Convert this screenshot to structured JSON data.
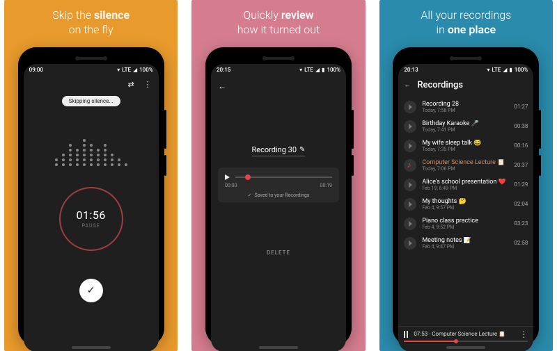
{
  "panels": [
    {
      "caption_line1": "Skip the",
      "caption_bold1": "silence",
      "caption_line2": "on the fly"
    },
    {
      "caption_line1": "Quickly",
      "caption_bold1": "review",
      "caption_line2": "how it turned out"
    },
    {
      "caption_line1": "All your recordings",
      "caption_line2": "in",
      "caption_bold2": "one place"
    }
  ],
  "status": {
    "time1": "09:00",
    "time2": "20:15",
    "time3": "20:13",
    "network": "LTE",
    "battery": "100%"
  },
  "recorder": {
    "chip": "Skipping silence...",
    "timer": "01:56",
    "timer_sub": "PAUSE"
  },
  "review": {
    "title": "Recording 30",
    "time_start": "00:00",
    "time_end": "00:19",
    "saved_text": "Saved to your Recordings",
    "delete_label": "DELETE"
  },
  "list": {
    "title": "Recordings",
    "items": [
      {
        "name": "Recording 28",
        "sub": "Today, 7:58 PM",
        "dur": "01:27",
        "accent": false,
        "emoji": ""
      },
      {
        "name": "Birthday Karaoke",
        "sub": "Today, 7:41 PM",
        "dur": "00:38",
        "accent": false,
        "emoji": "🎤"
      },
      {
        "name": "My wife sleep talk",
        "sub": "Today, 7:35 PM",
        "dur": "00:16",
        "accent": false,
        "emoji": "😂"
      },
      {
        "name": "Computer Science Lecture",
        "sub": "Today, 7:06 PM",
        "dur": "20:37",
        "accent": true,
        "emoji": "📋"
      },
      {
        "name": "Alice's school presentation",
        "sub": "Feb 19, 6:49 PM",
        "dur": "01:29",
        "accent": false,
        "emoji": "❤️"
      },
      {
        "name": "My thoughts",
        "sub": "Feb 4, 9:57 PM",
        "dur": "02:04",
        "accent": false,
        "emoji": "🤔"
      },
      {
        "name": "Piano class practice",
        "sub": "Feb 4, 9:52 PM",
        "dur": "03:23",
        "accent": false,
        "emoji": ""
      },
      {
        "name": "Meeting notes",
        "sub": "Feb 4, 9:47 PM",
        "dur": "02:58",
        "accent": false,
        "emoji": "📝"
      }
    ],
    "now_playing": {
      "elapsed": "07:53",
      "title": "Computer Science Lecture",
      "emoji": "📋"
    }
  }
}
